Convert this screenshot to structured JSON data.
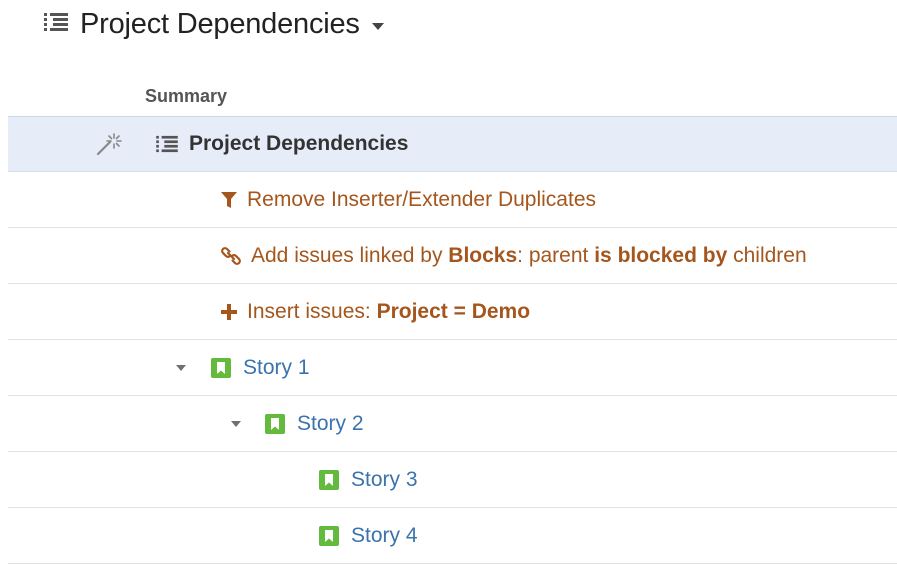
{
  "header": {
    "title": "Project Dependencies"
  },
  "columns": {
    "summary": "Summary"
  },
  "structure_root": {
    "label": "Project Dependencies"
  },
  "generators": [
    {
      "icon": "filter-icon",
      "parts": [
        {
          "t": "Remove Inserter/Extender Duplicates",
          "b": false
        }
      ]
    },
    {
      "icon": "link-icon",
      "parts": [
        {
          "t": "Add issues linked by ",
          "b": false
        },
        {
          "t": "Blocks",
          "b": true
        },
        {
          "t": ": parent ",
          "b": false
        },
        {
          "t": "is blocked by",
          "b": true
        },
        {
          "t": " children",
          "b": false
        }
      ]
    },
    {
      "icon": "plus-icon",
      "parts": [
        {
          "t": "Insert issues: ",
          "b": false
        },
        {
          "t": "Project = Demo",
          "b": true
        }
      ]
    }
  ],
  "issues": [
    {
      "label": "Story 1",
      "icon": "story-icon",
      "expanded": true
    },
    {
      "label": "Story 2",
      "icon": "story-icon",
      "expanded": true
    },
    {
      "label": "Story 3",
      "icon": "story-icon",
      "expanded": false
    },
    {
      "label": "Story 4",
      "icon": "story-icon",
      "expanded": false
    }
  ],
  "colors": {
    "generator_text": "#a4561d",
    "issue_link": "#3b73af",
    "story_icon": "#63ba3c",
    "selected_row": "#e6edf9"
  }
}
